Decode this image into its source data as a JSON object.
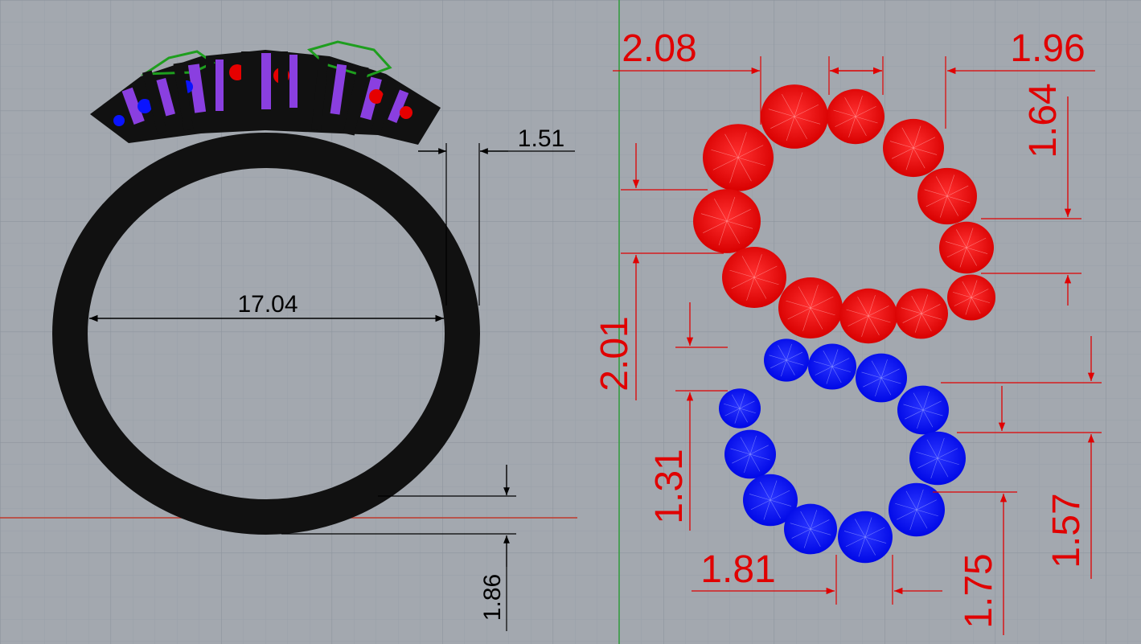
{
  "viewport": {
    "background": "#a3a8af",
    "grid_minor": "#98a0aa",
    "grid_major": "#8c949e",
    "x_axis_color": "#c0392b",
    "y_axis_color": "#2e9b3a"
  },
  "ring_dimensions": {
    "color": "#000000",
    "inner_diameter": "17.04",
    "shank_top_width": "1.51",
    "shank_bottom_thickness": "1.86"
  },
  "stone_dimensions": {
    "color": "#e00000",
    "outer_stone_size": "2.08",
    "outer_stone_size_right": "1.96",
    "outer_right_vertical": "1.64",
    "outer_left_vertical": "2.01",
    "inner_left_vertical": "1.31",
    "inner_bottom_left": "1.81",
    "inner_bottom_right": "1.75",
    "inner_right_vertical": "1.57"
  },
  "stones": {
    "outer_color": "#e60000",
    "inner_color": "#0a14ff"
  },
  "setting_colors": {
    "metal": "#111111",
    "prong_purple": "#8a3fe0",
    "wire_green": "#1e9e1e"
  }
}
